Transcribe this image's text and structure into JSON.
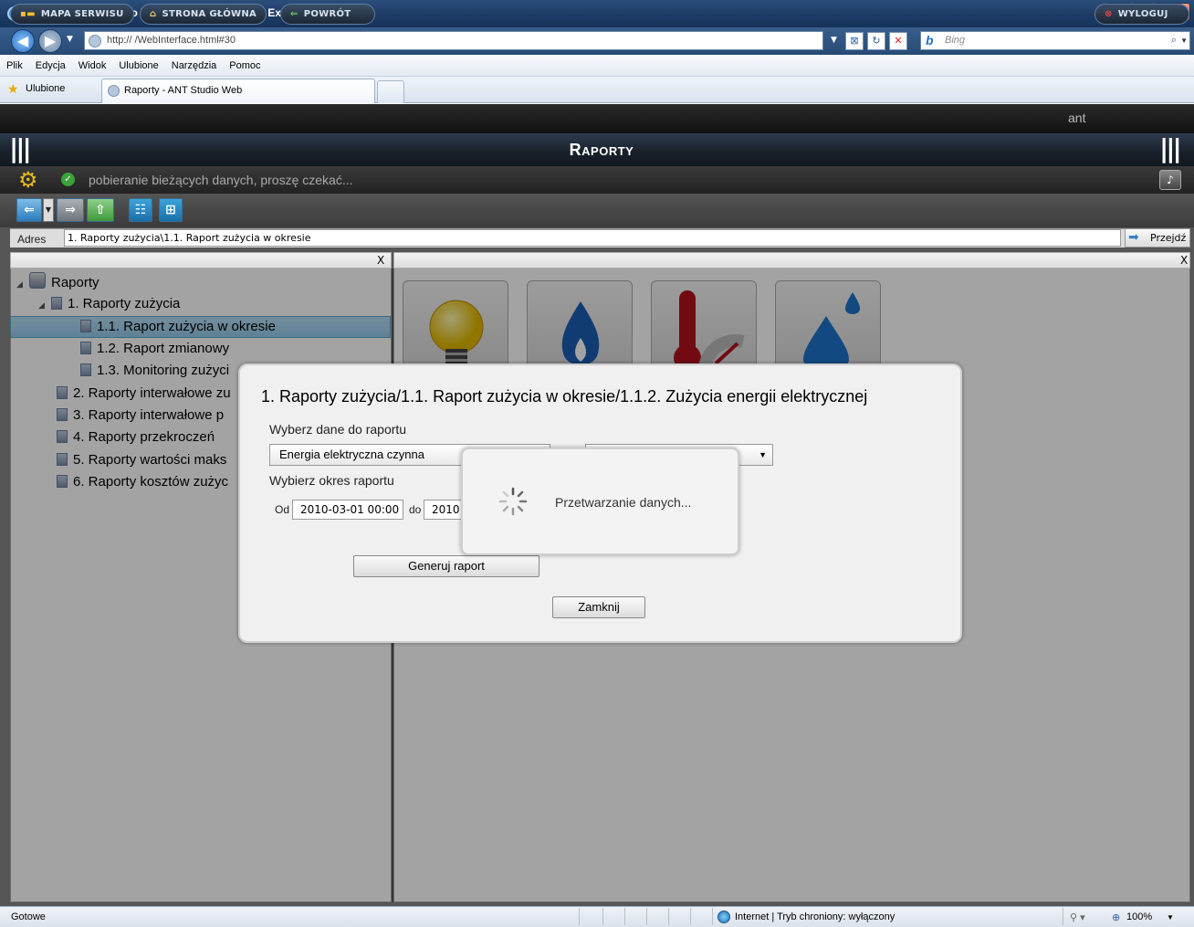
{
  "browser": {
    "window_title": "Raporty - ANT Studio Web - Windows Internet Explorer",
    "url": "http:// /WebInterface.html#30",
    "search_placeholder": "Bing",
    "menu": [
      "Plik",
      "Edycja",
      "Widok",
      "Ulubione",
      "Narzędzia",
      "Pomoc"
    ],
    "favorites_label": "Ulubione",
    "tab_title": "Raporty - ANT Studio Web",
    "status_left": "Gotowe",
    "status_zone": "Internet | Tryb chroniony: wyłączony",
    "zoom": "100%"
  },
  "app": {
    "nav_buttons": {
      "site_map": "MAPA SERWISU",
      "home": "STRONA GŁÓWNA",
      "back": "POWRÓT",
      "logout": "WYLOGUJ"
    },
    "user": "ant",
    "page_title": "Raporty",
    "status_message": "pobieranie bieżących danych, proszę czekać...",
    "address_label": "Adres",
    "address_value": "1. Raporty zużycia\\1.1. Raport zużycia w okresie",
    "go_label": "Przejdź",
    "close_glyph": "X",
    "tree": {
      "root": "Raporty",
      "items": [
        "1. Raporty zużycia",
        "1.1. Raport zużycia w okresie",
        "1.2. Raport zmianowy",
        "1.3. Monitoring zużyci",
        "2. Raporty interwałowe zu",
        "3. Raporty interwałowe p",
        "4. Raporty przekroczeń",
        "5. Raporty wartości maks",
        "6. Raporty kosztów zużyc"
      ]
    },
    "tiles": [
      "bulb-icon",
      "gas-flame-icon",
      "thermometer-icon",
      "water-drop-icon"
    ]
  },
  "dialog": {
    "title": "1. Raporty zużycia/1.1. Raport zużycia w okresie/1.1.2. Zużycia energii elektrycznej",
    "select_label": "Wyberz dane do raportu",
    "select_value": "Energia elektryczna czynna",
    "period_label": "Wybierz okres raportu",
    "from_label": "Od",
    "from_value": "2010-03-01 00:00",
    "to_label": "do",
    "to_value": "2010",
    "generate_button": "Generuj raport",
    "close_button": "Zamknij",
    "processing_text": "Przetwarzanie danych..."
  }
}
